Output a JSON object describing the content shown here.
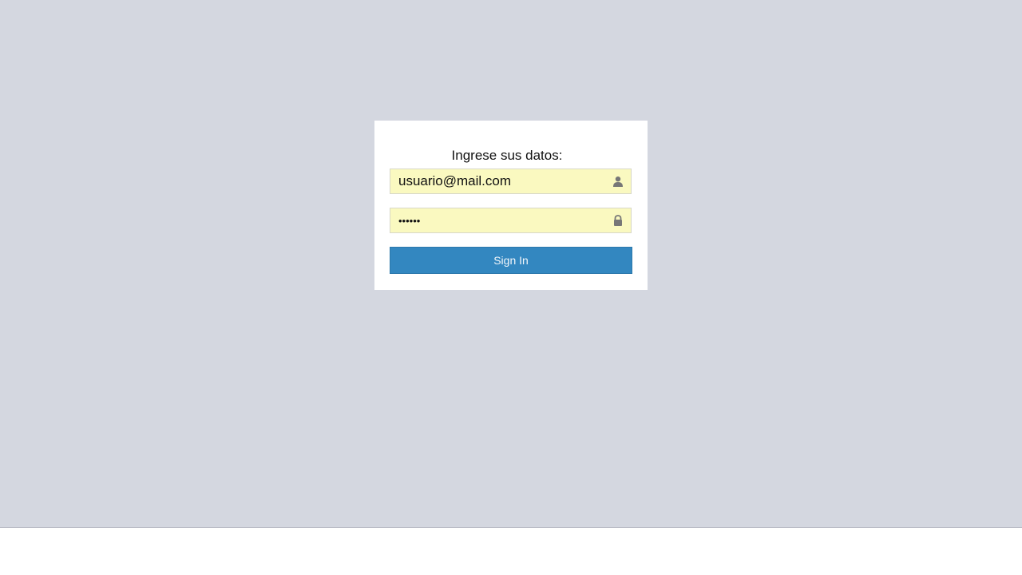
{
  "login": {
    "title": "Ingrese sus datos:",
    "email_value": "usuario@mail.com",
    "password_value": "••••••",
    "signin_label": "Sign In"
  },
  "icons": {
    "email_icon": "user-icon",
    "password_icon": "lock-icon"
  },
  "colors": {
    "background": "#d4d7e0",
    "input_background": "#faf9c0",
    "button": "#3387c0"
  }
}
